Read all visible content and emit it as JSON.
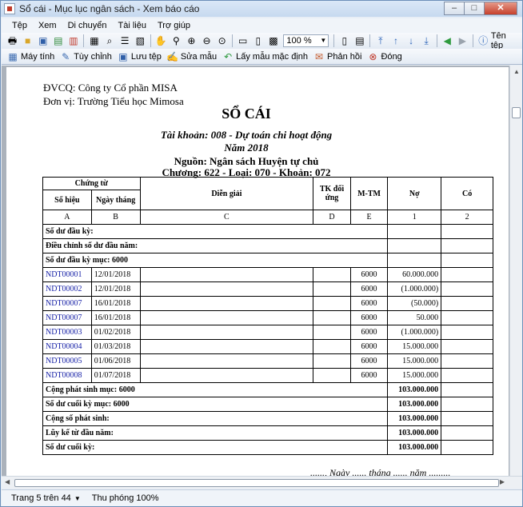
{
  "window": {
    "title": "Sổ cái - Mục lục ngân sách - Xem báo cáo"
  },
  "menu": [
    "Tệp",
    "Xem",
    "Di chuyển",
    "Tài liệu",
    "Trợ giúp"
  ],
  "toolbar": {
    "zoom": "100 %",
    "ten_tep": "Tên tệp",
    "buttons": [
      "Máy tính",
      "Tùy chỉnh",
      "Lưu tệp",
      "Sửa mẫu",
      "Lấy mẫu mặc định",
      "Phản hồi",
      "Đóng"
    ]
  },
  "report": {
    "dvcq": "ĐVCQ: Công ty Cổ phần MISA",
    "donvi": "Đơn vị: Trường Tiểu học Mimosa",
    "title": "SỔ CÁI",
    "taikhoan": "Tài khoản: 008 - Dự toán chi hoạt động",
    "nam": "Năm 2018",
    "nguon": "Nguồn: Ngân sách Huyện tự chủ",
    "chuong": "Chương: 622 - Loại: 070 - Khoản: 072",
    "headers": {
      "chung_tu": "Chứng từ",
      "so_hieu": "Số hiệu",
      "ngay_thang": "Ngày tháng",
      "dien_giai": "Diễn giải",
      "tk_doi_ung": "TK đối ứng",
      "mtm": "M-TM",
      "no": "Nợ",
      "co": "Có"
    },
    "codes": [
      "A",
      "B",
      "C",
      "D",
      "E",
      "1",
      "2"
    ],
    "summary_top": [
      "Số dư đầu kỳ:",
      "Điều chỉnh số dư đầu năm:",
      "Số dư đầu kỳ mục: 6000"
    ],
    "rows": [
      {
        "so_hieu": "NDT00001",
        "ngay": "12/01/2018",
        "mtm": "6000",
        "no": "60.000.000"
      },
      {
        "so_hieu": "NDT00002",
        "ngay": "12/01/2018",
        "mtm": "6000",
        "no": "(1.000.000)"
      },
      {
        "so_hieu": "NDT00007",
        "ngay": "16/01/2018",
        "mtm": "6000",
        "no": "(50.000)"
      },
      {
        "so_hieu": "NDT00007",
        "ngay": "16/01/2018",
        "mtm": "6000",
        "no": "50.000"
      },
      {
        "so_hieu": "NDT00003",
        "ngay": "01/02/2018",
        "mtm": "6000",
        "no": "(1.000.000)"
      },
      {
        "so_hieu": "NDT00004",
        "ngay": "01/03/2018",
        "mtm": "6000",
        "no": "15.000.000"
      },
      {
        "so_hieu": "NDT00005",
        "ngay": "01/06/2018",
        "mtm": "6000",
        "no": "15.000.000"
      },
      {
        "so_hieu": "NDT00008",
        "ngay": "01/07/2018",
        "mtm": "6000",
        "no": "15.000.000"
      }
    ],
    "summary_bottom": [
      {
        "label": "Cộng phát sinh mục: 6000",
        "no": "103.000.000"
      },
      {
        "label": "Số dư cuối kỳ mục: 6000",
        "no": "103.000.000"
      },
      {
        "label": "Cộng số phát sinh:",
        "no": "103.000.000"
      },
      {
        "label": "Lũy kế từ đầu năm:",
        "no": "103.000.000"
      },
      {
        "label": "Số dư cuối kỳ:",
        "no": "103.000.000"
      }
    ],
    "footer_date": "......, Ngày ...... tháng ...... năm ........."
  },
  "status": {
    "page": "Trang 5 trên 44",
    "zoom": "Thu phóng 100%"
  }
}
